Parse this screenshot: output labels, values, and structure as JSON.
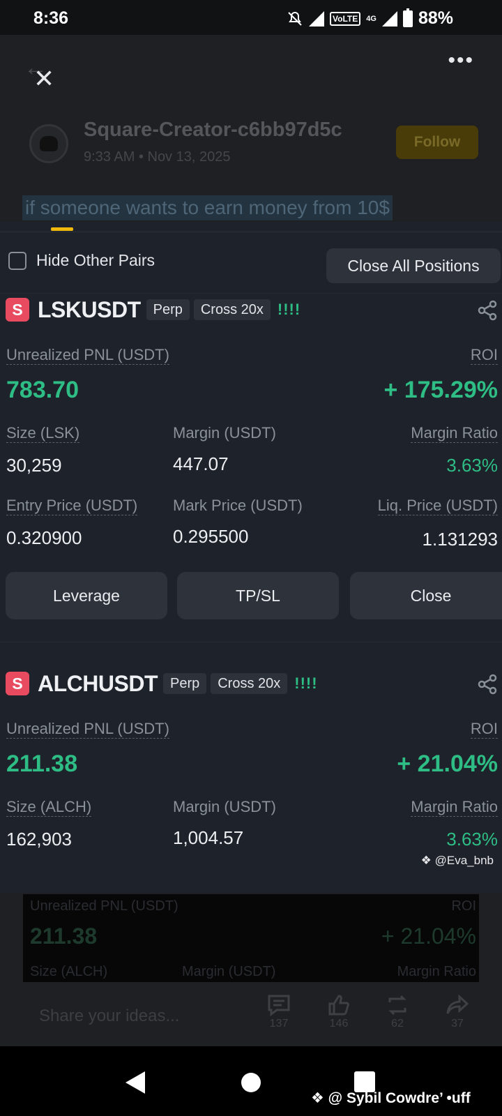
{
  "status_bar": {
    "time": "8:36",
    "network": "4G",
    "volte": "VoLTE",
    "battery": "88%"
  },
  "post": {
    "author": "Square-Creator-c6bb97d5c",
    "timestamp": "9:33 AM • Nov 13, 2025",
    "follow_label": "Follow",
    "text": "if someone wants to earn money from 10$",
    "comment_placeholder": "Share your ideas...",
    "counts": {
      "comments": "137",
      "likes": "146",
      "reposts": "62",
      "shares": "37"
    },
    "dim_preview": {
      "pnl_label": "Unrealized PNL (USDT)",
      "roi_label": "ROI",
      "pnl_value": "211.38",
      "roi_value": "+ 21.04%",
      "size_label": "Size (ALCH)",
      "margin_label": "Margin (USDT)",
      "margin_ratio_label": "Margin Ratio"
    }
  },
  "panel": {
    "hide_other_pairs": "Hide Other Pairs",
    "close_all": "Close All Positions",
    "watermark": "@Eva_bnb",
    "positions": [
      {
        "icon_letter": "S",
        "symbol": "LSKUSDT",
        "type": "Perp",
        "mode": "Cross 20x",
        "bars": "!!!!",
        "pnl_label": "Unrealized PNL (USDT)",
        "roi_label": "ROI",
        "pnl": "783.70",
        "roi": "+ 175.29%",
        "size_label": "Size (LSK)",
        "size": "30,259",
        "margin_label": "Margin (USDT)",
        "margin": "447.07",
        "margin_ratio_label": "Margin Ratio",
        "margin_ratio": "3.63%",
        "entry_label": "Entry Price (USDT)",
        "entry": "0.320900",
        "mark_label": "Mark Price (USDT)",
        "mark": "0.295500",
        "liq_label": "Liq. Price (USDT)",
        "liq": "1.131293",
        "buttons": [
          "Leverage",
          "TP/SL",
          "Close"
        ]
      },
      {
        "icon_letter": "S",
        "symbol": "ALCHUSDT",
        "type": "Perp",
        "mode": "Cross 20x",
        "bars": "!!!!",
        "pnl_label": "Unrealized PNL (USDT)",
        "roi_label": "ROI",
        "pnl": "211.38",
        "roi": "+ 21.04%",
        "size_label": "Size (ALCH)",
        "size": "162,903",
        "margin_label": "Margin (USDT)",
        "margin": "1,004.57",
        "margin_ratio_label": "Margin Ratio",
        "margin_ratio": "3.63%"
      }
    ]
  },
  "nav_watermark": "@ Sybil Cowdre’ •uff",
  "colors": {
    "profit_green": "#2ebd85",
    "brand_yellow": "#f0b90b",
    "panel_bg": "#1e222a",
    "symbol_icon_red": "#e84a5f"
  }
}
